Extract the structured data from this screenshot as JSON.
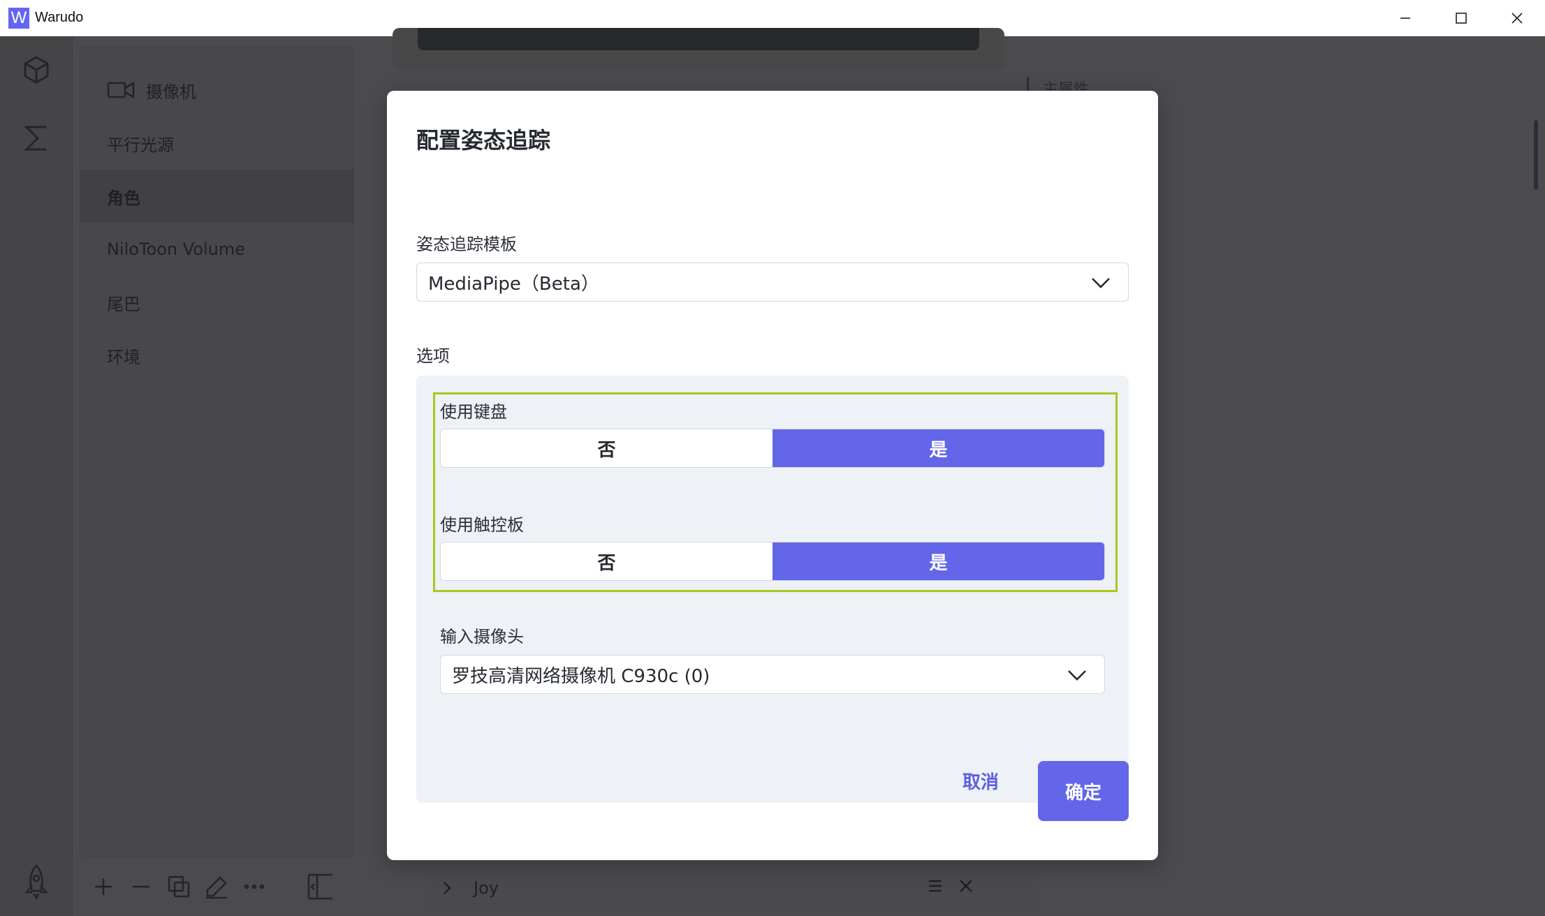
{
  "window": {
    "app_logo": "W",
    "title": "Warudo",
    "controls": [
      "minimize-icon",
      "maximize-icon",
      "close-icon"
    ]
  },
  "rail": {
    "icons": [
      "cube-icon",
      "sigma-icon",
      "rocket-icon"
    ]
  },
  "sidebar": {
    "items": [
      {
        "label": "摄像机",
        "icon": "camera-icon",
        "active": false
      },
      {
        "label": "平行光源",
        "active": false
      },
      {
        "label": "角色",
        "active": true
      },
      {
        "label": "NiloToon Volume",
        "active": false
      },
      {
        "label": "尾巴",
        "active": false
      },
      {
        "label": "环境",
        "active": false
      }
    ],
    "toolbar_icons": [
      "plus-icon",
      "minus-icon",
      "duplicate-icon",
      "edit-icon",
      "more-icon",
      "panel-toggle-icon"
    ]
  },
  "background": {
    "property_heading": "主属性",
    "joy_label": "Joy"
  },
  "dialog": {
    "title": "配置姿态追踪",
    "template_label": "姿态追踪模板",
    "template_value": "MediaPipe（Beta）",
    "options_label": "选项",
    "use_keyboard": {
      "label": "使用键盘",
      "no": "否",
      "yes": "是",
      "selected": "是"
    },
    "use_touchpad": {
      "label": "使用触控板",
      "no": "否",
      "yes": "是",
      "selected": "是"
    },
    "camera_label": "输入摄像头",
    "camera_value": "罗技高清网络摄像机 C930c (0)",
    "cancel": "取消",
    "confirm": "确定"
  },
  "colors": {
    "accent": "#6366e8",
    "highlight_border": "#a6c91a",
    "overlay": "#4b4b4f"
  }
}
